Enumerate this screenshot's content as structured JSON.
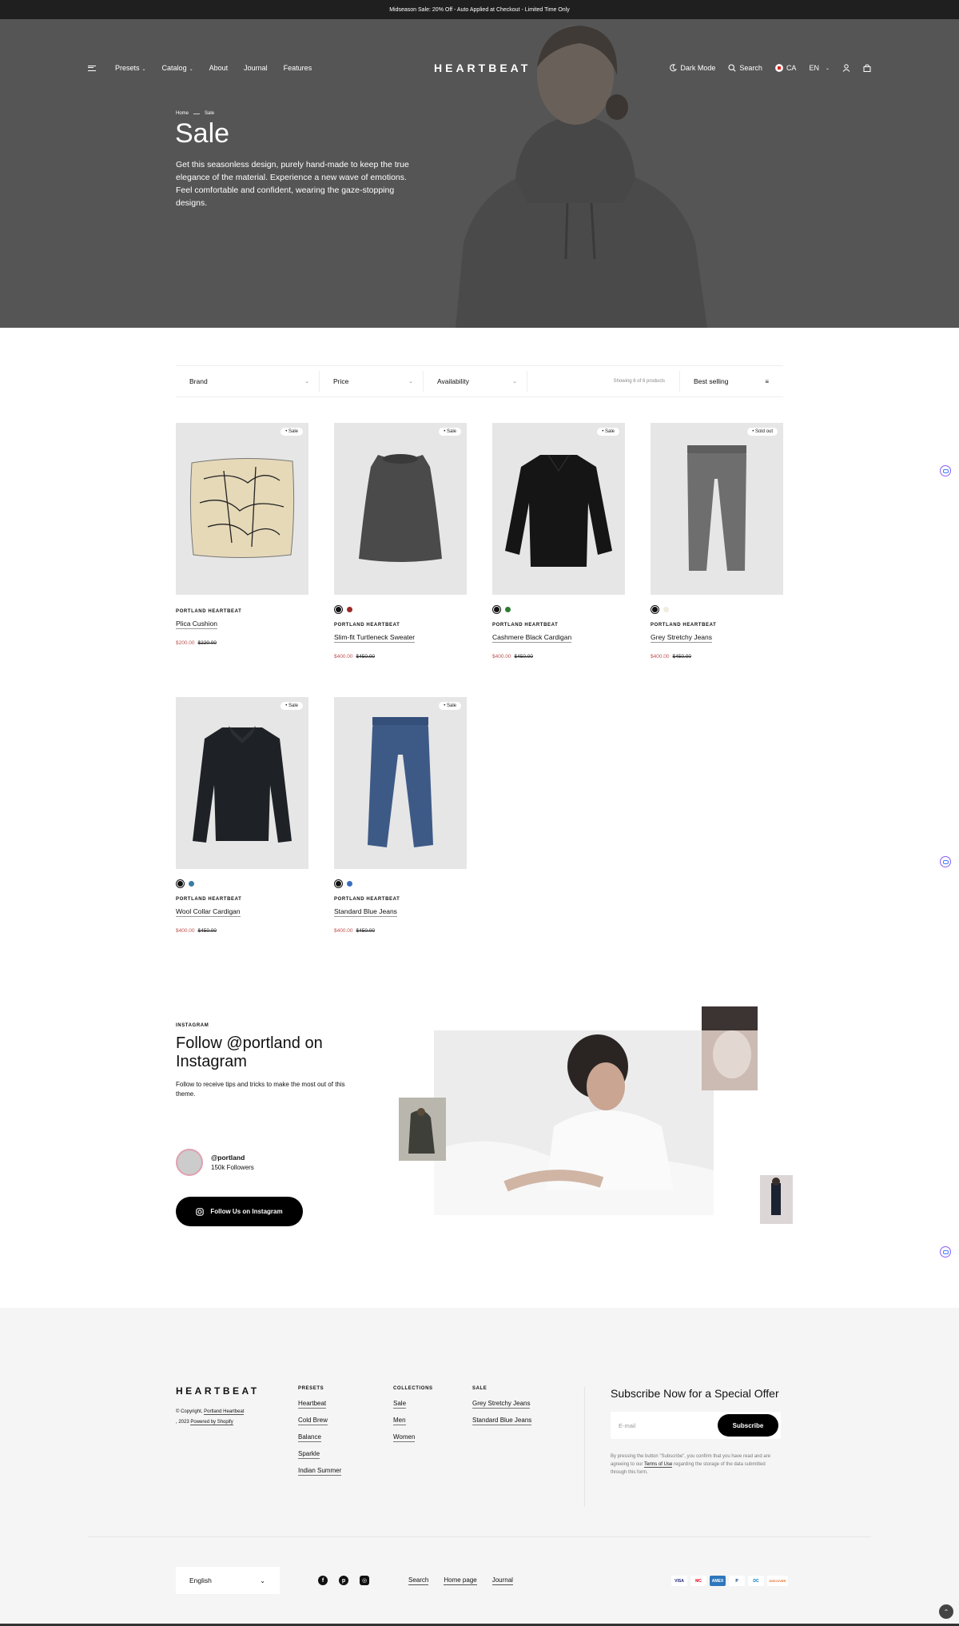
{
  "announcement": "Midseason Sale: 20% Off - Auto Applied at Checkout - Limited Time Only",
  "header": {
    "logo": "HEARTBEAT",
    "nav": [
      "Presets",
      "Catalog",
      "About",
      "Journal",
      "Features"
    ],
    "dark_mode": "Dark Mode",
    "search": "Search",
    "country": "CA",
    "language": "EN"
  },
  "hero": {
    "breadcrumb": [
      "Home",
      "Sale"
    ],
    "title": "Sale",
    "description": "Get this seasonless design, purely hand-made to keep the true elegance of the material. Experience a new wave of emotions. Feel comfortable and confident, wearing the gaze-stopping designs."
  },
  "filters": {
    "brand": "Brand",
    "price": "Price",
    "availability": "Availability",
    "showing": "Showing 6 of 6 products",
    "sort": "Best selling"
  },
  "products": [
    {
      "badge": "• Sale",
      "vendor": "PORTLAND HEARTBEAT",
      "name": "Plica Cushion",
      "price": "$200.00",
      "compare": "$220.00",
      "swatches": []
    },
    {
      "badge": "• Sale",
      "vendor": "PORTLAND HEARTBEAT",
      "name": "Slim-fit Turtleneck Sweater",
      "price": "$400.00",
      "compare": "$450.00",
      "swatches": [
        "#111111",
        "#a02828"
      ]
    },
    {
      "badge": "• Sale",
      "vendor": "PORTLAND HEARTBEAT",
      "name": "Cashmere Black Cardigan",
      "price": "$400.00",
      "compare": "$450.00",
      "swatches": [
        "#111111",
        "#2e7d32"
      ]
    },
    {
      "badge": "• Sold out",
      "vendor": "PORTLAND HEARTBEAT",
      "name": "Grey Stretchy Jeans",
      "price": "$400.00",
      "compare": "$450.00",
      "swatches": [
        "#111111",
        "#f0ede0"
      ]
    },
    {
      "badge": "• Sale",
      "vendor": "PORTLAND HEARTBEAT",
      "name": "Wool Collar Cardigan",
      "price": "$400.00",
      "compare": "$450.00",
      "swatches": [
        "#111111",
        "#3a7ca5"
      ]
    },
    {
      "badge": "• Sale",
      "vendor": "PORTLAND HEARTBEAT",
      "name": "Standard Blue Jeans",
      "price": "$400.00",
      "compare": "$450.00",
      "swatches": [
        "#111111",
        "#3a6fbf"
      ]
    }
  ],
  "instagram": {
    "tag": "INSTAGRAM",
    "title": "Follow @portland on Instagram",
    "text": "Follow to receive tips and tricks to make the most out of this theme.",
    "handle": "@portland",
    "followers": "150k Followers",
    "button": "Follow Us on Instagram"
  },
  "footer": {
    "logo": "HEARTBEAT",
    "copyright_prefix": "© Copyright,",
    "copyright_link": "Portland Heartbeat",
    "copyright_year": ", 2023",
    "powered": "Powered by Shopify",
    "columns": [
      {
        "heading": "PRESETS",
        "links": [
          "Heartbeat",
          "Cold Brew",
          "Balance",
          "Sparkle",
          "Indian Summer"
        ]
      },
      {
        "heading": "COLLECTIONS",
        "links": [
          "Sale",
          "Men",
          "Women"
        ]
      },
      {
        "heading": "SALE",
        "links": [
          "Grey Stretchy Jeans",
          "Standard Blue Jeans"
        ]
      }
    ],
    "subscribe_title": "Subscribe Now for a Special Offer",
    "email_placeholder": "E-mail",
    "subscribe_button": "Subscribe",
    "note_before": "By pressing the button \"Subscribe\", you confirm that you have read and are agreeing to our",
    "note_link": "Terms of Use",
    "note_after": "regarding the storage of the data submitted through this form.",
    "language": "English",
    "bottom_links": [
      "Search",
      "Home page",
      "Journal"
    ],
    "payments": [
      "VISA",
      "MC",
      "AMEX",
      "P",
      "DC",
      "DISCOVER"
    ]
  }
}
